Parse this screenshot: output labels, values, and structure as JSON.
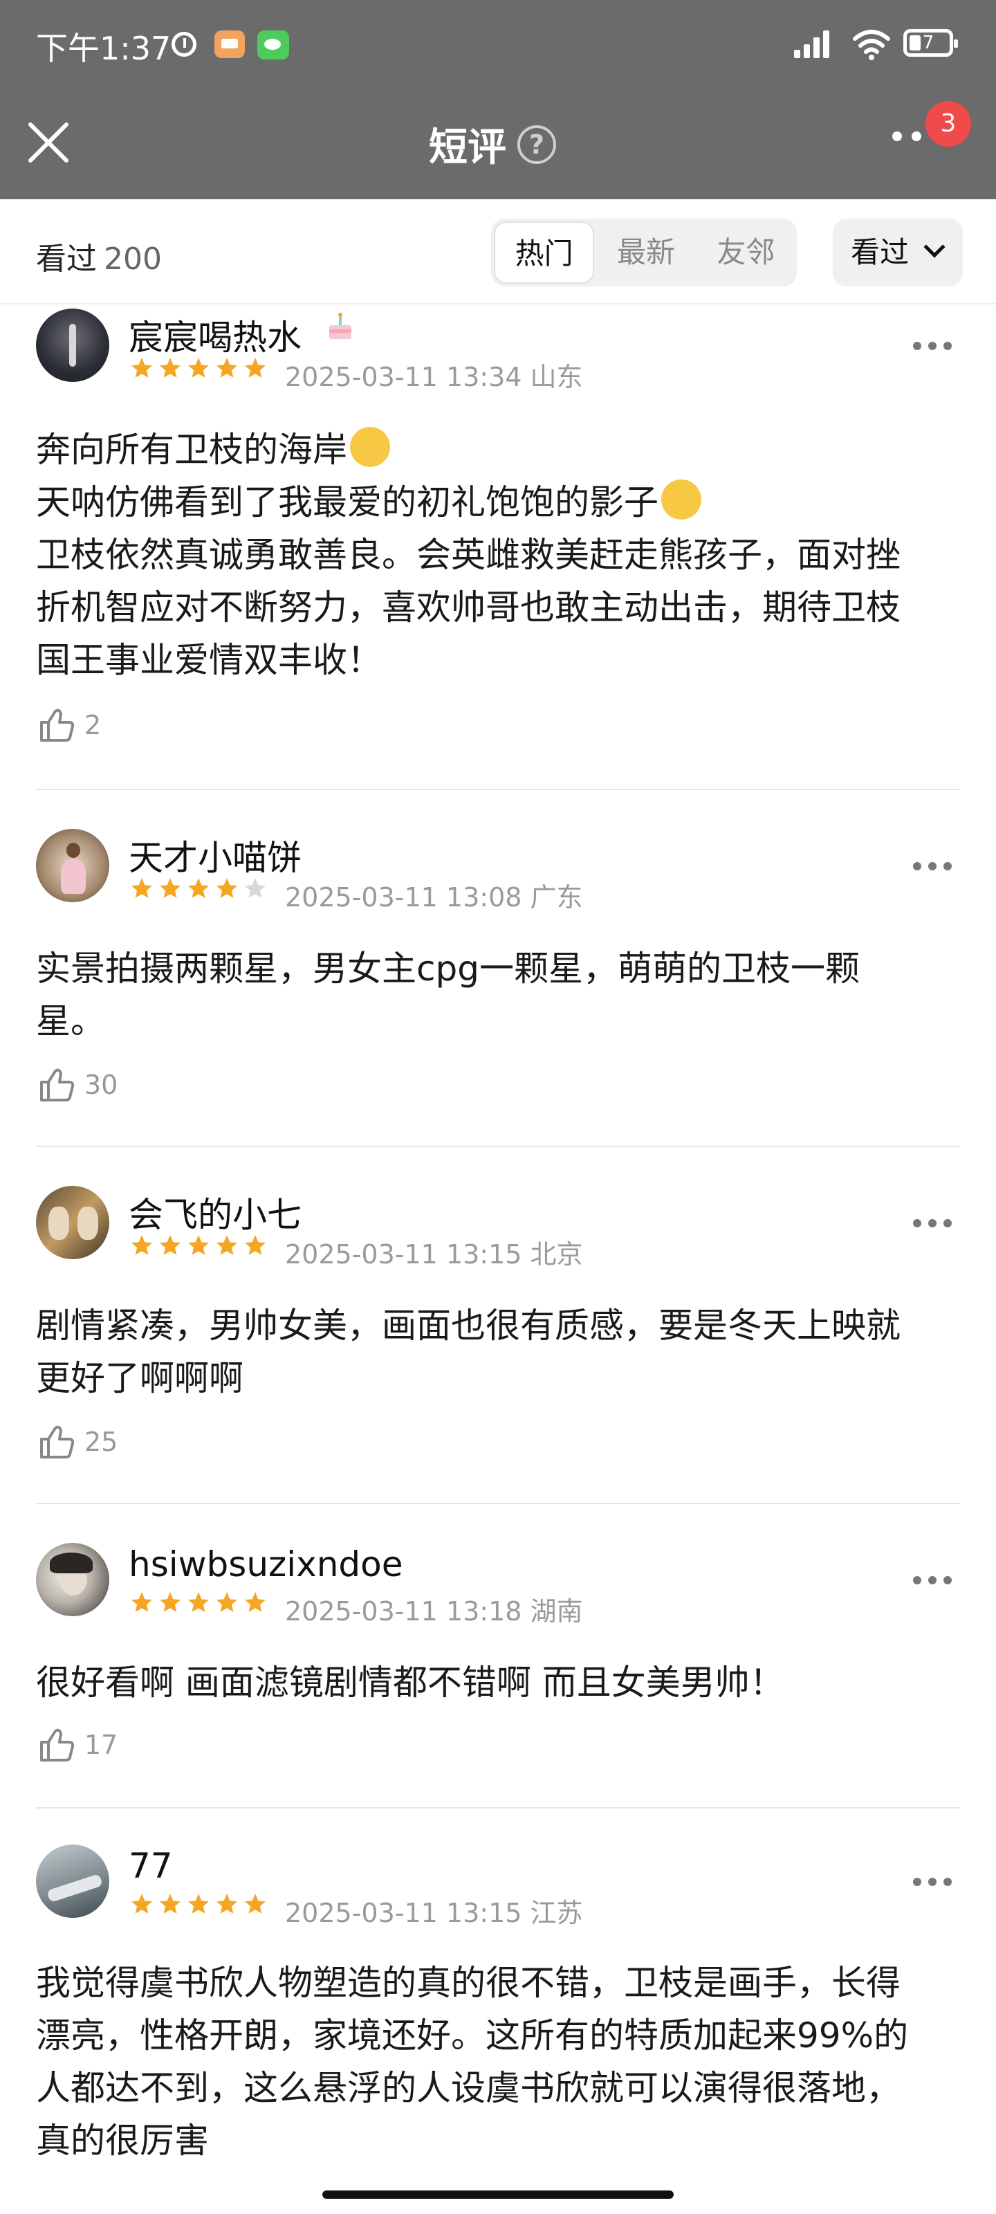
{
  "status_bar": {
    "time": "下午1:37",
    "battery": "7",
    "icons": [
      "timer-icon",
      "app-notification-icon",
      "wechat-icon",
      "signal-icon",
      "wifi-icon",
      "battery-icon"
    ]
  },
  "header": {
    "title": "短评",
    "help_icon": "?",
    "badge_count": "3",
    "icons": [
      "close-icon",
      "help-icon",
      "more-icon"
    ]
  },
  "filter_bar": {
    "seen_label": "看过",
    "seen_count": "200",
    "tabs": [
      {
        "label": "热门",
        "active": true
      },
      {
        "label": "最新",
        "active": false
      },
      {
        "label": "友邻",
        "active": false
      }
    ],
    "dropdown_label": "看过"
  },
  "comments": [
    {
      "username": "宸宸喝热水",
      "stars": 5,
      "time": "2025-03-11 13:34",
      "location": "山东",
      "lines": [
        "奔向所有卫枝的海岸",
        "天呐仿佛看到了我最爱的初礼饱饱的影子",
        "卫枝依然真诚勇敢善良。会英雌救美赶走熊孩子，面对挫",
        "折机智应对不断努力，喜欢帅哥也敢主动出击，期待卫枝",
        "国王事业爱情双丰收！"
      ],
      "likes": "2"
    },
    {
      "username": "天才小喵饼",
      "stars": 4,
      "time": "2025-03-11 13:08",
      "location": "广东",
      "lines": [
        "实景拍摄两颗星，男女主cpg一颗星，萌萌的卫枝一颗",
        "星。"
      ],
      "likes": "30"
    },
    {
      "username": "会飞的小七",
      "stars": 5,
      "time": "2025-03-11 13:15",
      "location": "北京",
      "lines": [
        "剧情紧凑，男帅女美，画面也很有质感，要是冬天上映就",
        "更好了啊啊啊"
      ],
      "likes": "25"
    },
    {
      "username": "hsiwbsuzixndoe",
      "stars": 5,
      "time": "2025-03-11 13:18",
      "location": "湖南",
      "lines": [
        "很好看啊 画面滤镜剧情都不错啊 而且女美男帅！"
      ],
      "likes": "17"
    },
    {
      "username": "77",
      "stars": 5,
      "time": "2025-03-11 13:15",
      "location": "江苏",
      "lines": [
        "我觉得虞书欣人物塑造的真的很不错，卫枝是画手，长得",
        "漂亮，性格开朗，家境还好。这所有的特质加起来99%的",
        "人都达不到，这么悬浮的人设虞书欣就可以演得很落地，",
        "真的很厉害"
      ],
      "likes": ""
    }
  ],
  "colors": {
    "header_bg": "#6b6b6b",
    "star": "#f5a623",
    "star_empty": "#d8d8d8",
    "badge": "#f04a4a"
  }
}
